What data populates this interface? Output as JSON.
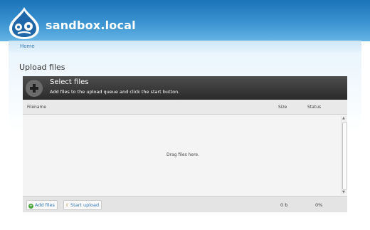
{
  "site": {
    "name": "sandbox.local",
    "logo_icon": "drupal-drop-icon"
  },
  "nav": {
    "home": "Home"
  },
  "page": {
    "title": "Upload files"
  },
  "uploader": {
    "header_title": "Select files",
    "header_subtitle": "Add files to the upload queue and click the start button.",
    "columns": {
      "filename": "Filename",
      "size": "Size",
      "status": "Status"
    },
    "drop_hint": "Drag files here.",
    "buttons": {
      "add": "Add files",
      "start": "Start upload"
    },
    "totals": {
      "size": "0 b",
      "percent": "0%"
    }
  },
  "colors": {
    "header_blue": "#1b74b9",
    "link_blue": "#2f74b2",
    "uploader_dark": "#2a2a2a"
  }
}
